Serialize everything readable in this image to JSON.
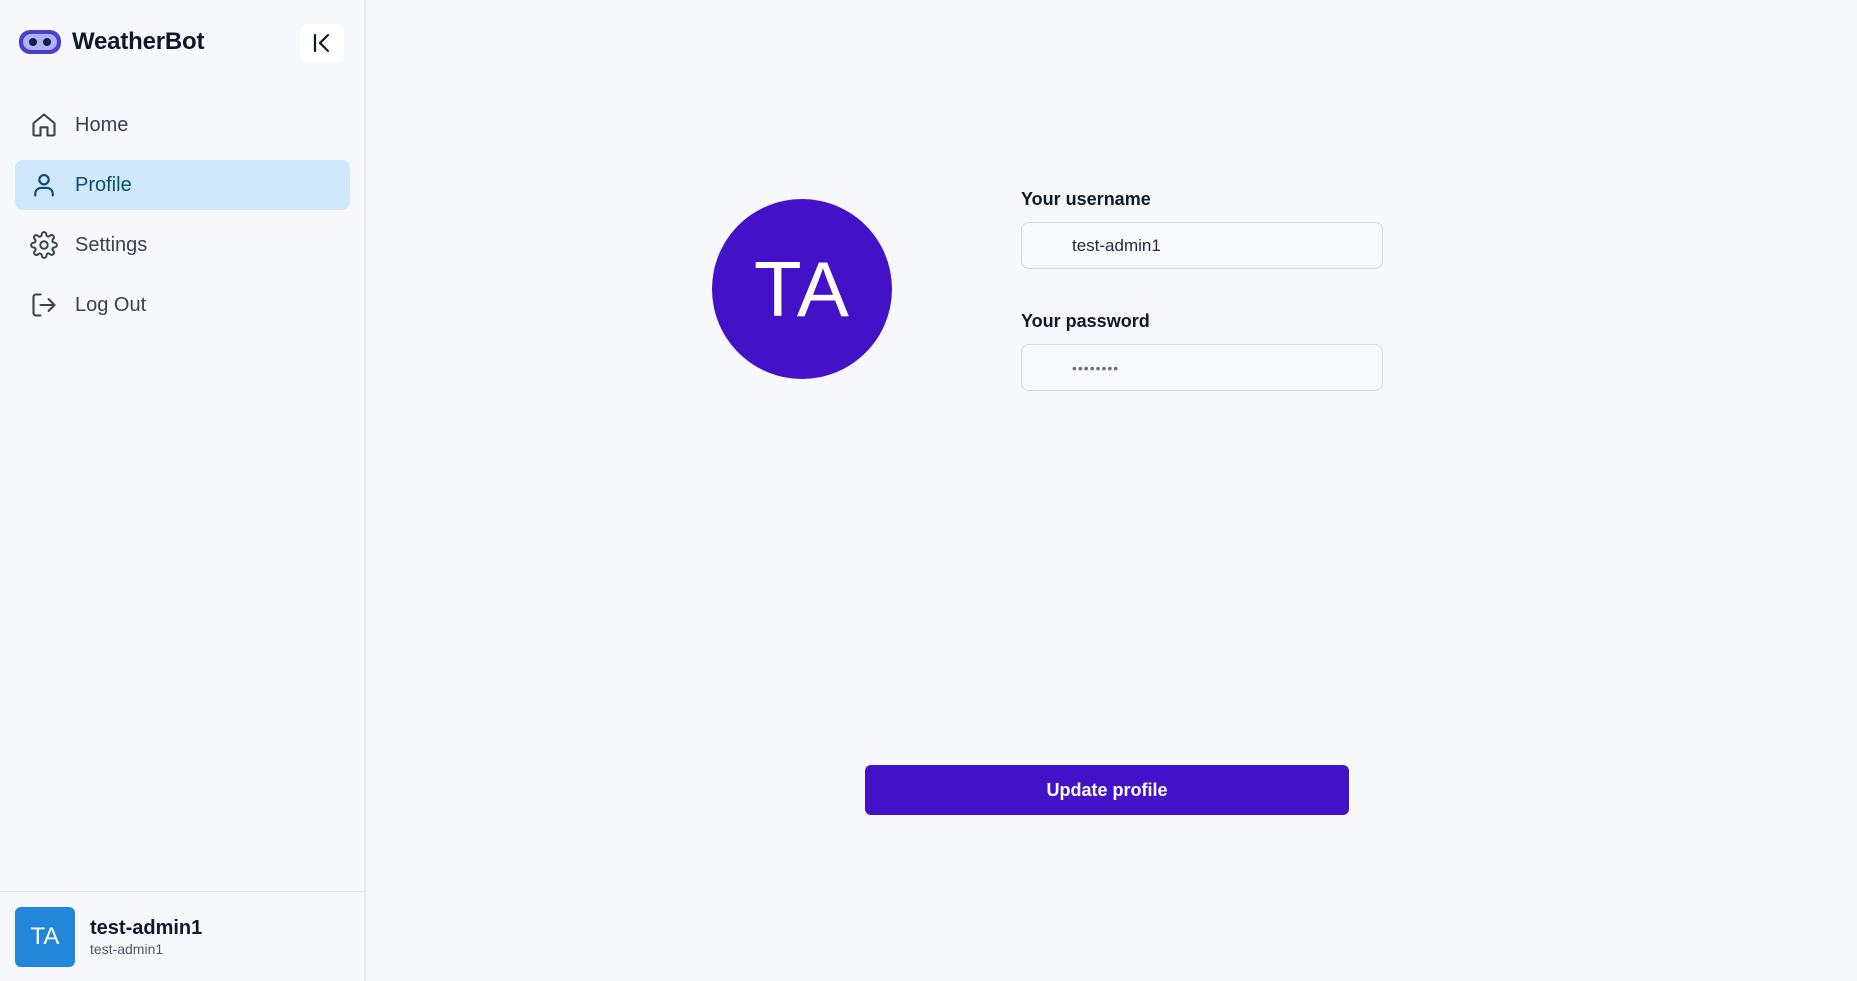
{
  "brand": {
    "name": "WeatherBot",
    "logo_icon": "robot-face-icon",
    "accent": "#4312c8"
  },
  "sidebar": {
    "collapse_icon": "collapse-left-icon",
    "items": [
      {
        "label": "Home",
        "icon": "home-icon",
        "active": false
      },
      {
        "label": "Profile",
        "icon": "user-icon",
        "active": true
      },
      {
        "label": "Settings",
        "icon": "gear-icon",
        "active": false
      },
      {
        "label": "Log Out",
        "icon": "logout-icon",
        "active": false
      }
    ],
    "user": {
      "initials": "TA",
      "name": "test-admin1",
      "subtitle": "test-admin1"
    }
  },
  "profile": {
    "avatar_initials": "TA",
    "username_label": "Your username",
    "username_value": "test-admin1",
    "password_label": "Your password",
    "password_value": "••••••••",
    "submit_label": "Update profile"
  }
}
